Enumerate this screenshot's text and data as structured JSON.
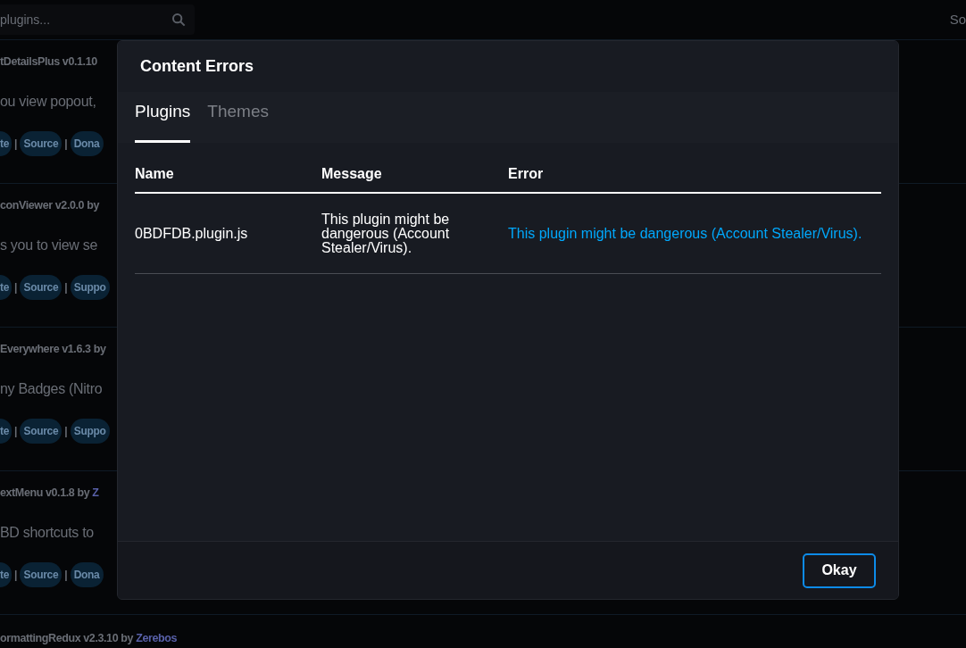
{
  "background": {
    "search": {
      "placeholder": "plugins..."
    },
    "sort_label": "So",
    "cards": [
      {
        "title": "tDetailsPlus v0.1.10",
        "description": "ou view popout,",
        "links": [
          "te",
          "Source",
          "Dona"
        ]
      },
      {
        "title": "conViewer v2.0.0 by",
        "description": "s you to view se",
        "links": [
          "te",
          "Source",
          "Suppo"
        ]
      },
      {
        "title": "Everywhere v1.6.3 by",
        "description": "ny Badges (Nitro",
        "links": [
          "te",
          "Source",
          "Suppo"
        ]
      },
      {
        "title": "extMenu v0.1.8 by ",
        "author": "Z",
        "description": "BD shortcuts to",
        "links": [
          "te",
          "Source",
          "Dona"
        ]
      },
      {
        "title": "ormattingRedux v2.3.10 by ",
        "author": "Zerebos"
      }
    ],
    "separator": "|"
  },
  "dialog": {
    "title": "Content Errors",
    "tabs": [
      {
        "label": "Plugins",
        "selected": true
      },
      {
        "label": "Themes",
        "selected": false
      }
    ],
    "table": {
      "columns": [
        "Name",
        "Message",
        "Error"
      ],
      "rows": [
        {
          "name": "0BDFDB.plugin.js",
          "message": "This plugin might be dangerous (Account Stealer/Virus).",
          "error": "This plugin might be dangerous (Account Stealer/Virus)."
        }
      ]
    },
    "buttons": [
      "Okay"
    ]
  }
}
